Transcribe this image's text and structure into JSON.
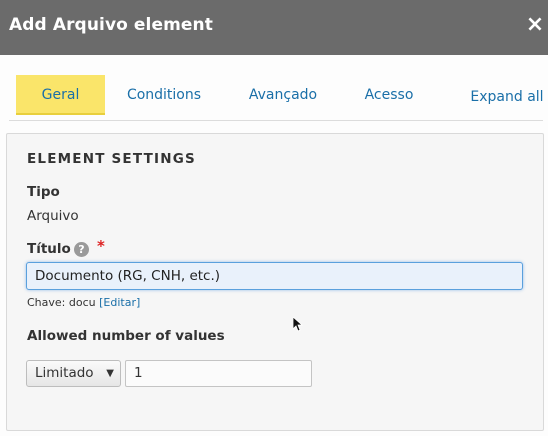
{
  "dialog": {
    "title": "Add Arquivo element",
    "close_symbol": "×"
  },
  "tabs": [
    {
      "label": "Geral",
      "active": true
    },
    {
      "label": "Conditions",
      "active": false
    },
    {
      "label": "Avançado",
      "active": false
    },
    {
      "label": "Acesso",
      "active": false
    }
  ],
  "expand_all_label": "Expand all",
  "settings": {
    "section_title": "ELEMENT SETTINGS",
    "tipo_label": "Tipo",
    "tipo_value": "Arquivo",
    "titulo_label": "Título",
    "help_symbol": "?",
    "required_marker": "*",
    "titulo_value": "Documento (RG, CNH, etc.)",
    "key_prefix": "Chave: docu",
    "edit_link": "[Editar]",
    "allowed_label": "Allowed number of values",
    "limit_select_value": "Limitado",
    "limit_number_value": "1"
  },
  "icons": {
    "close": "close-icon",
    "help": "help-icon",
    "dropdown": "chevron-down-icon",
    "pointer": "mouse-pointer-icon"
  },
  "colors": {
    "titlebar": "#6b6b6b",
    "active_tab": "#fae56a",
    "link": "#1a6fa8",
    "required": "#dd2222",
    "focused_input_border": "#5aa0dd"
  }
}
